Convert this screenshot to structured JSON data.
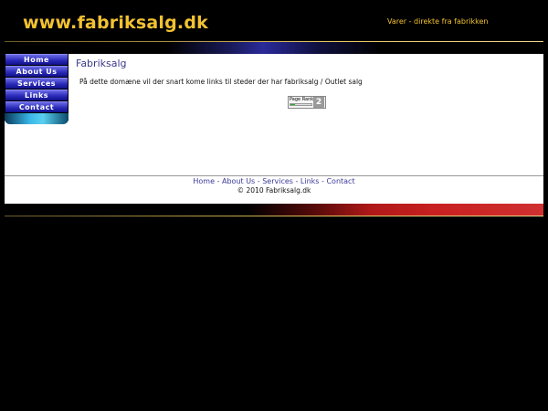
{
  "header": {
    "site_title": "www.fabriksalg.dk",
    "tagline": "Varer - direkte fra fabrikken"
  },
  "sidebar": {
    "items": [
      {
        "label": "Home"
      },
      {
        "label": "About Us"
      },
      {
        "label": "Services"
      },
      {
        "label": "Links"
      },
      {
        "label": "Contact"
      }
    ]
  },
  "main": {
    "title": "Fabriksalg",
    "intro": "På dette domæne vil der snart kome links til steder der har fabriksalg / Outlet salg"
  },
  "pagerank": {
    "label": "Page Rank",
    "value": "2",
    "fill_fraction": 0.2
  },
  "footer": {
    "links": [
      {
        "label": "Home"
      },
      {
        "label": "About Us"
      },
      {
        "label": "Services"
      },
      {
        "label": "Links"
      },
      {
        "label": "Contact"
      }
    ],
    "separator": " - ",
    "copyright": "© 2010 Fabriksalg.dk"
  },
  "colors": {
    "background": "#000000",
    "title_gold": "#f2c230",
    "content_bg": "#ffffff",
    "nav_blue": "#2a2ab8",
    "link_blue": "#3a3a9a",
    "band_red": "#c82020"
  }
}
